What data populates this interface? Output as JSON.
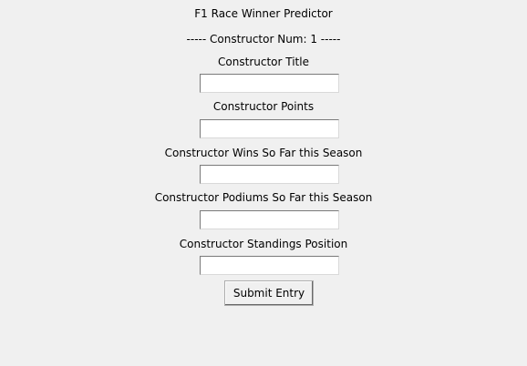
{
  "window": {
    "title": "F1 Race Winner Predictor",
    "subtitle": "----- Constructor Num: 1 -----"
  },
  "form": {
    "fields": [
      {
        "label": "Constructor Title",
        "value": ""
      },
      {
        "label": "Constructor Points",
        "value": ""
      },
      {
        "label": "Constructor Wins So Far this Season",
        "value": ""
      },
      {
        "label": "Constructor Podiums So Far this Season",
        "value": ""
      },
      {
        "label": "Constructor Standings Position",
        "value": ""
      }
    ],
    "submit_label": "Submit Entry"
  }
}
